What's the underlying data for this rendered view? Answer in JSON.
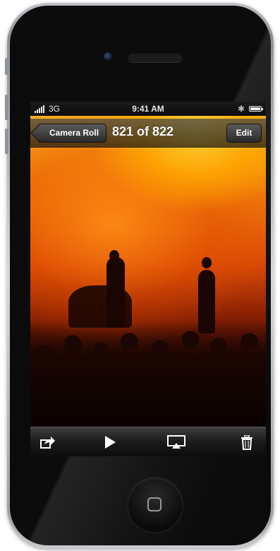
{
  "status_bar": {
    "carrier": "3G",
    "time": "9:41 AM",
    "bluetooth_icon": "bluetooth-icon",
    "battery_icon": "battery-icon"
  },
  "nav_bar": {
    "back_label": "Camera Roll",
    "title": "821 of 822",
    "edit_label": "Edit"
  },
  "toolbar": {
    "icons": [
      "share-icon",
      "play-icon",
      "airplay-icon",
      "trash-icon"
    ]
  },
  "photo": {
    "subject": "concert-photo"
  },
  "colors": {
    "bar_dark": "#1b1b1b",
    "button_grey": "#3a3a3a",
    "photo_orange": "#f07a0a"
  }
}
